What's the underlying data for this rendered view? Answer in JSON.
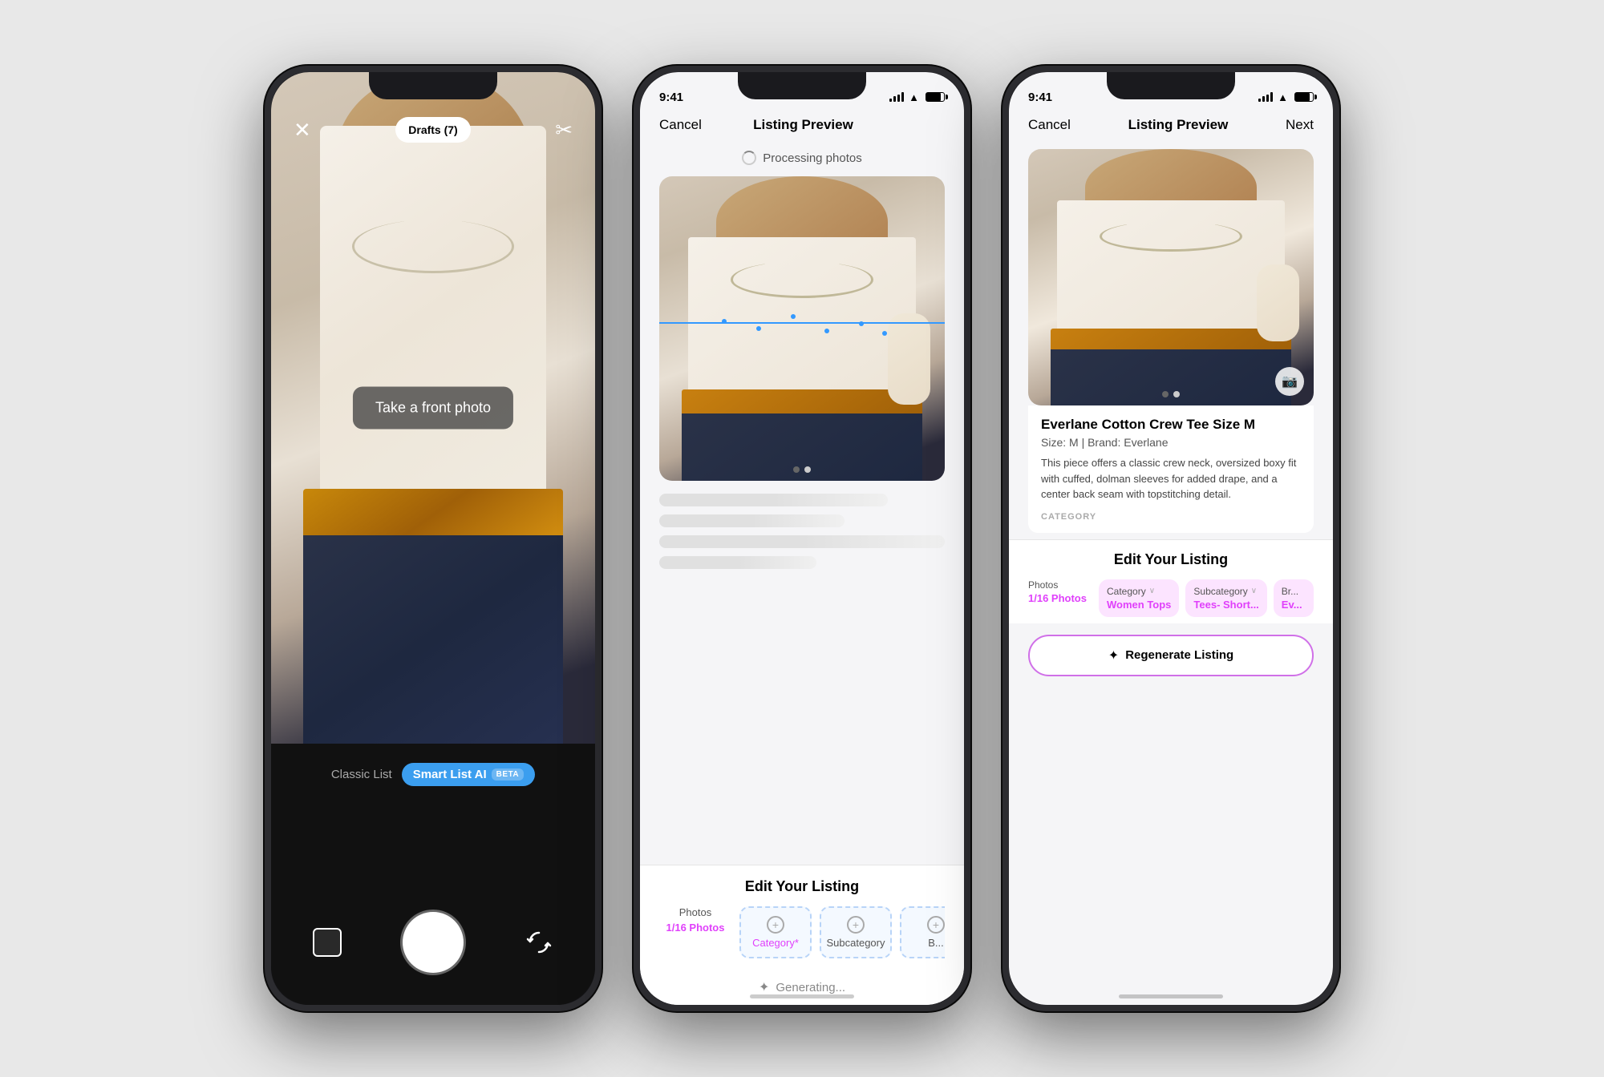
{
  "phone1": {
    "top_bar": {
      "close_label": "✕",
      "drafts_label": "Drafts (7)",
      "scissors_label": "✂"
    },
    "overlay_text": "Take a front photo",
    "bottom": {
      "classic_label": "Classic List",
      "smart_label": "Smart List AI",
      "beta_label": "BETA"
    }
  },
  "phone2": {
    "status_bar": {
      "time": "9:41"
    },
    "nav": {
      "cancel": "Cancel",
      "title": "Listing Preview",
      "next": ""
    },
    "processing": {
      "text": "Processing photos"
    },
    "edit_section": {
      "title": "Edit Your Listing",
      "tab_photos_label": "Photos",
      "tab_photos_value": "1/16 Photos",
      "tab_category_label": "Category*",
      "tab_subcategory_label": "Subcategory",
      "tab_brand_label": "B..."
    },
    "generating": {
      "text": "Generating..."
    }
  },
  "phone3": {
    "status_bar": {
      "time": "9:41"
    },
    "nav": {
      "cancel": "Cancel",
      "title": "Listing Preview",
      "next": "Next"
    },
    "listing": {
      "title": "Everlane Cotton Crew Tee Size M",
      "meta": "Size: M  |  Brand: Everlane",
      "description": "This piece offers a classic crew neck, oversized boxy fit with cuffed, dolman sleeves for added drape, and a center back seam with topstitching detail.",
      "category_label": "CATEGORY"
    },
    "edit_section": {
      "title": "Edit Your Listing",
      "tab_photos_label": "Photos",
      "tab_photos_value": "1/16 Photos",
      "tab_category_label": "Category",
      "tab_category_chevron": "∨",
      "tab_category_value": "Women Tops",
      "tab_subcategory_label": "Subcategory",
      "tab_subcategory_chevron": "∨",
      "tab_subcategory_value": "Tees- Short...",
      "tab_brand_label": "Br...",
      "tab_brand_value": "Ev..."
    },
    "regen_button": {
      "icon": "✦",
      "label": "Regenerate Listing"
    }
  }
}
